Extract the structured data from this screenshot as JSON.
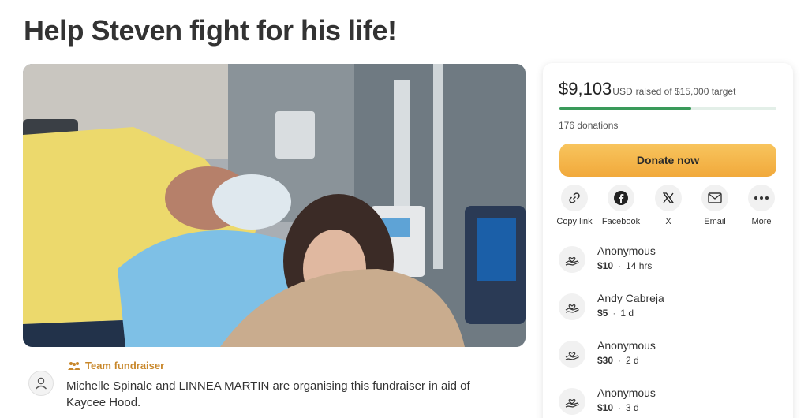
{
  "page": {
    "title": "Help Steven fight for his life!"
  },
  "hero_image": {
    "description_icon": "hospital-photo"
  },
  "organiser": {
    "team_label": "Team fundraiser",
    "text": "Michelle Spinale and LINNEA MARTIN are organising this fundraiser in aid of Kaycee Hood."
  },
  "progress": {
    "amount": "$9,103",
    "currency": "USD",
    "rest": "raised of $15,000 target",
    "fraction": 0.607,
    "donations": "176 donations"
  },
  "donate_label": "Donate now",
  "share": [
    {
      "label": "Copy link",
      "icon": "link-icon"
    },
    {
      "label": "Facebook",
      "icon": "facebook-icon"
    },
    {
      "label": "X",
      "icon": "x-icon"
    },
    {
      "label": "Email",
      "icon": "email-icon"
    },
    {
      "label": "More",
      "icon": "more-icon"
    }
  ],
  "donors": [
    {
      "name": "Anonymous",
      "amount": "$10",
      "time": "14 hrs"
    },
    {
      "name": "Andy Cabreja",
      "amount": "$5",
      "time": "1 d"
    },
    {
      "name": "Anonymous",
      "amount": "$30",
      "time": "2 d"
    },
    {
      "name": "Anonymous",
      "amount": "$10",
      "time": "3 d"
    }
  ],
  "colors": {
    "accent": "#f1a93b",
    "progress": "#3a9a5a",
    "team": "#c8872a"
  }
}
